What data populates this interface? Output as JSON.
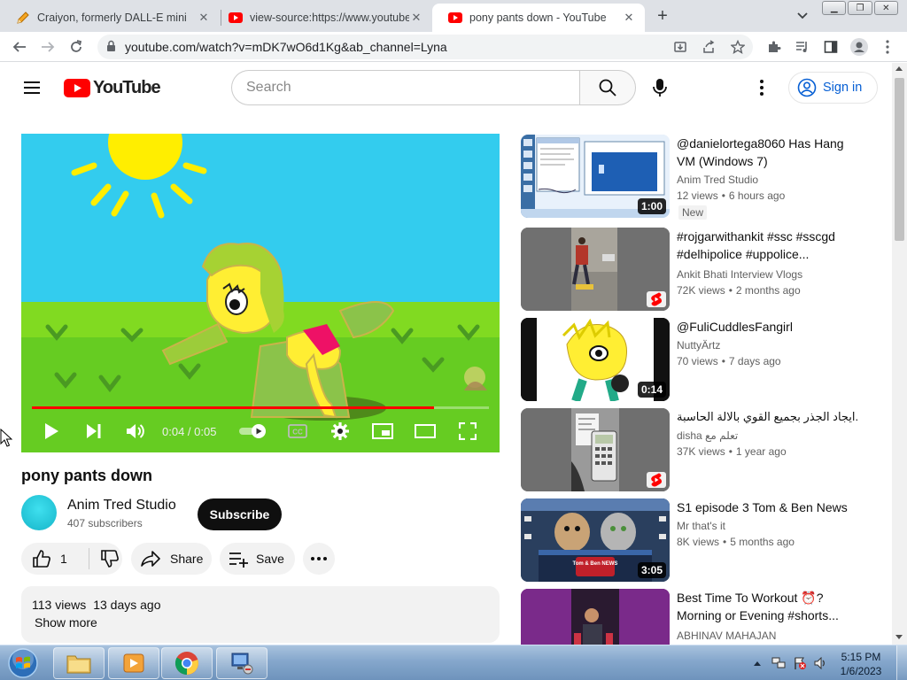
{
  "browser": {
    "tabs": [
      {
        "title": "Craiyon, formerly DALL-E mini",
        "icon": "pencil-favicon"
      },
      {
        "title": "view-source:https://www.youtube",
        "icon": "youtube-favicon"
      },
      {
        "title": "pony pants down - YouTube",
        "icon": "youtube-favicon",
        "active": true
      }
    ],
    "url": "youtube.com/watch?v=mDK7wO6d1Kg&ab_channel=Lyna"
  },
  "youtube": {
    "logo_text": "YouTube",
    "search_placeholder": "Search",
    "sign_in_label": "Sign in"
  },
  "player": {
    "current_time": "0:04",
    "separator": " / ",
    "duration": "0:05",
    "progress_fraction": 0.88
  },
  "video": {
    "title": "pony pants down",
    "channel": "Anim Tred Studio",
    "subscribers": "407 subscribers",
    "subscribe_label": "Subscribe",
    "likes": "1",
    "share_label": "Share",
    "save_label": "Save",
    "views": "113 views",
    "age": "13 days ago",
    "show_more": "Show more"
  },
  "related": [
    {
      "title": "@danielortega8060 Has Hang VM (Windows 7)",
      "channel": "Anim Tred Studio",
      "views": "12 views",
      "age": "6 hours ago",
      "duration": "1:00",
      "badge": "New"
    },
    {
      "title": "#rojgarwithankit #ssc #sscgd #delhipolice #uppolice...",
      "channel": "Ankit Bhati Interview Vlogs",
      "views": "72K views",
      "age": "2 months ago",
      "shorts": true
    },
    {
      "title": "@FuliCuddlesFangirl",
      "channel": "NuttyÄrtz",
      "views": "70 views",
      "age": "7 days ago",
      "duration": "0:14"
    },
    {
      "title": "ايجاد الجذر بجميع القوي بالالة الحاسبة.",
      "channel": "disha تعلم مع",
      "views": "37K views",
      "age": "1 year ago",
      "shorts": true
    },
    {
      "title": "S1 episode 3 Tom & Ben News",
      "channel": "Mr that's it",
      "views": "8K views",
      "age": "5 months ago",
      "duration": "3:05"
    },
    {
      "title": "Best Time To Workout ⏰? Morning or Evening #shorts...",
      "channel": "ABHINAV MAHAJAN",
      "views": "",
      "age": ""
    }
  ],
  "thumb_texts": {
    "tom_ben_logo": "Tom & Ben NEWS"
  },
  "taskbar": {
    "time": "5:15 PM",
    "date": "1/6/2023"
  },
  "colors": {
    "youtube_red": "#ff0000",
    "link_blue": "#065fd4",
    "progress_red": "#ff0000"
  }
}
